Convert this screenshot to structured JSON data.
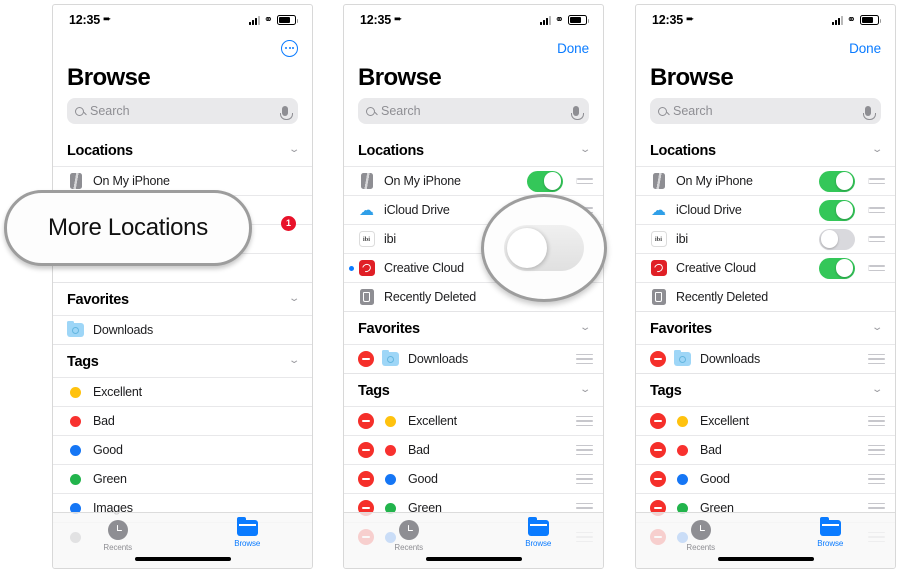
{
  "status_bar": {
    "time": "12:35",
    "location_icon": "location-arrow-icon",
    "signal_icon": "cellular-signal-icon",
    "wifi_icon": "wifi-icon",
    "battery_icon": "battery-icon"
  },
  "screen_title": "Browse",
  "search": {
    "placeholder": "Search",
    "value": ""
  },
  "nav": {
    "more_label": "",
    "done_label": "Done"
  },
  "sections": {
    "locations": {
      "title": "Locations",
      "chevron": "⌄"
    },
    "favorites": {
      "title": "Favorites",
      "chevron": "⌄"
    },
    "tags": {
      "title": "Tags",
      "chevron": "⌄"
    }
  },
  "locations_items": [
    {
      "label": "On My iPhone",
      "icon": "iphone-icon",
      "toggle": "on"
    },
    {
      "label": "iCloud Drive",
      "icon": "icloud-icon",
      "toggle": "on"
    },
    {
      "label": "ibi",
      "icon": "ibi-icon",
      "toggle": "off"
    },
    {
      "label": "Creative Cloud",
      "icon": "creative-cloud-icon",
      "toggle": "on"
    },
    {
      "label": "Recently Deleted",
      "icon": "trash-icon",
      "toggle": "none"
    }
  ],
  "favorites_items": [
    {
      "label": "Downloads",
      "icon": "downloads-folder-icon"
    }
  ],
  "tags_items": [
    {
      "label": "Excellent",
      "color": "#ffc20e"
    },
    {
      "label": "Bad",
      "color": "#f8312f"
    },
    {
      "label": "Good",
      "color": "#1576f5"
    },
    {
      "label": "Green",
      "color": "#22b44c"
    },
    {
      "label": "Images",
      "color": "#1576f5"
    }
  ],
  "badge": {
    "count": "1",
    "color": "#e8122a"
  },
  "tab_bar": {
    "tabs": [
      {
        "label": "Recents",
        "icon": "clock-icon",
        "active": false
      },
      {
        "label": "Browse",
        "icon": "folder-icon",
        "active": true
      }
    ]
  },
  "callouts": {
    "more_locations": "More Locations",
    "magnified_toggle_state": "off"
  },
  "ibi_icon_text": "ibi"
}
